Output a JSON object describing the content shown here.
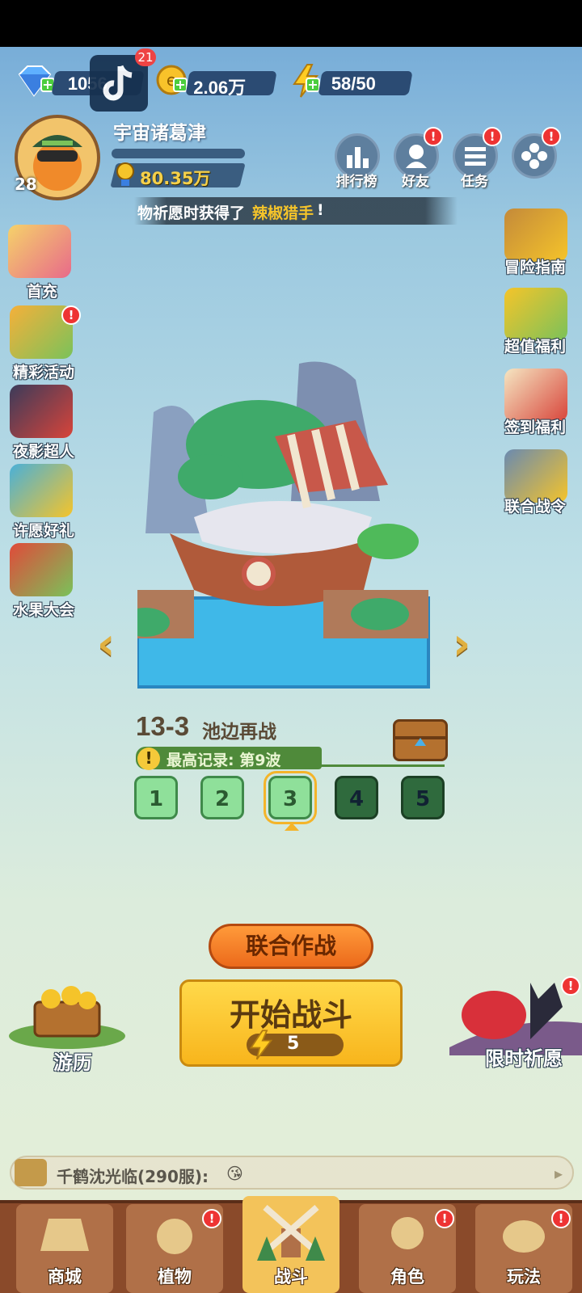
{
  "resources": {
    "gems": "1056",
    "coins": "2.06万",
    "energy": "58/50"
  },
  "tiktok_badge": "21",
  "profile": {
    "level": "28",
    "name": "宇宙诸葛津",
    "trophy": "80.35万"
  },
  "top_buttons": [
    {
      "label": "排行榜"
    },
    {
      "label": "好友",
      "badge": "!"
    },
    {
      "label": "任务",
      "badge": "!"
    },
    {
      "label": "",
      "badge": "!"
    }
  ],
  "marquee": {
    "prefix": "物祈愿时获得了",
    "highlight": "辣椒猎手",
    "suffix": "!"
  },
  "left_menu": [
    {
      "label": "首充"
    },
    {
      "label": "精彩活动",
      "badge": "!"
    },
    {
      "label": "夜影超人"
    },
    {
      "label": "许愿好礼"
    },
    {
      "label": "水果大会"
    }
  ],
  "right_menu": [
    {
      "label": "冒险指南"
    },
    {
      "label": "超值福利"
    },
    {
      "label": "签到福利"
    },
    {
      "label": "联合战令"
    }
  ],
  "stage": {
    "number": "13-3",
    "name": "池边再战",
    "record": "最高记录: 第9波",
    "levels": [
      "1",
      "2",
      "3",
      "4",
      "5"
    ],
    "selected_level": "3"
  },
  "actions": {
    "coop": "联合作战",
    "start": "开始战斗",
    "start_cost": "5",
    "journey": "游历",
    "limited_wish": "限时祈愿"
  },
  "chat": {
    "sender": "千鹤沈光临(290服):",
    "emoji": "😘"
  },
  "nav": [
    {
      "label": "商城"
    },
    {
      "label": "植物",
      "badge": "!"
    },
    {
      "label": "战斗"
    },
    {
      "label": "角色",
      "badge": "!"
    },
    {
      "label": "玩法",
      "badge": "!"
    }
  ],
  "colors": {
    "accent_gold": "#f5d04a",
    "badge_red": "#e33",
    "start_button": "#f8b51c",
    "coop_button": "#ec6a1b"
  }
}
